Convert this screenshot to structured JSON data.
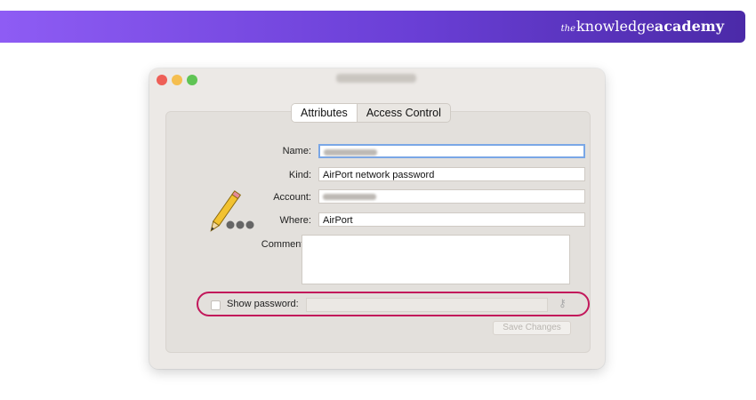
{
  "brand": {
    "the": "the",
    "knowledge": "knowledge",
    "academy": "academy"
  },
  "tabs": [
    {
      "label": "Attributes",
      "selected": true
    },
    {
      "label": "Access Control",
      "selected": false
    }
  ],
  "form": {
    "name_label": "Name:",
    "kind_label": "Kind:",
    "kind_value": "AirPort network password",
    "account_label": "Account:",
    "where_label": "Where:",
    "where_value": "AirPort",
    "comments_label": "Comments:",
    "show_password_label": "Show password:",
    "save_button": "Save Changes"
  },
  "colors": {
    "banner_start": "#8e5cf4",
    "banner_end": "#4b2aa8",
    "highlight": "#c2185b"
  }
}
